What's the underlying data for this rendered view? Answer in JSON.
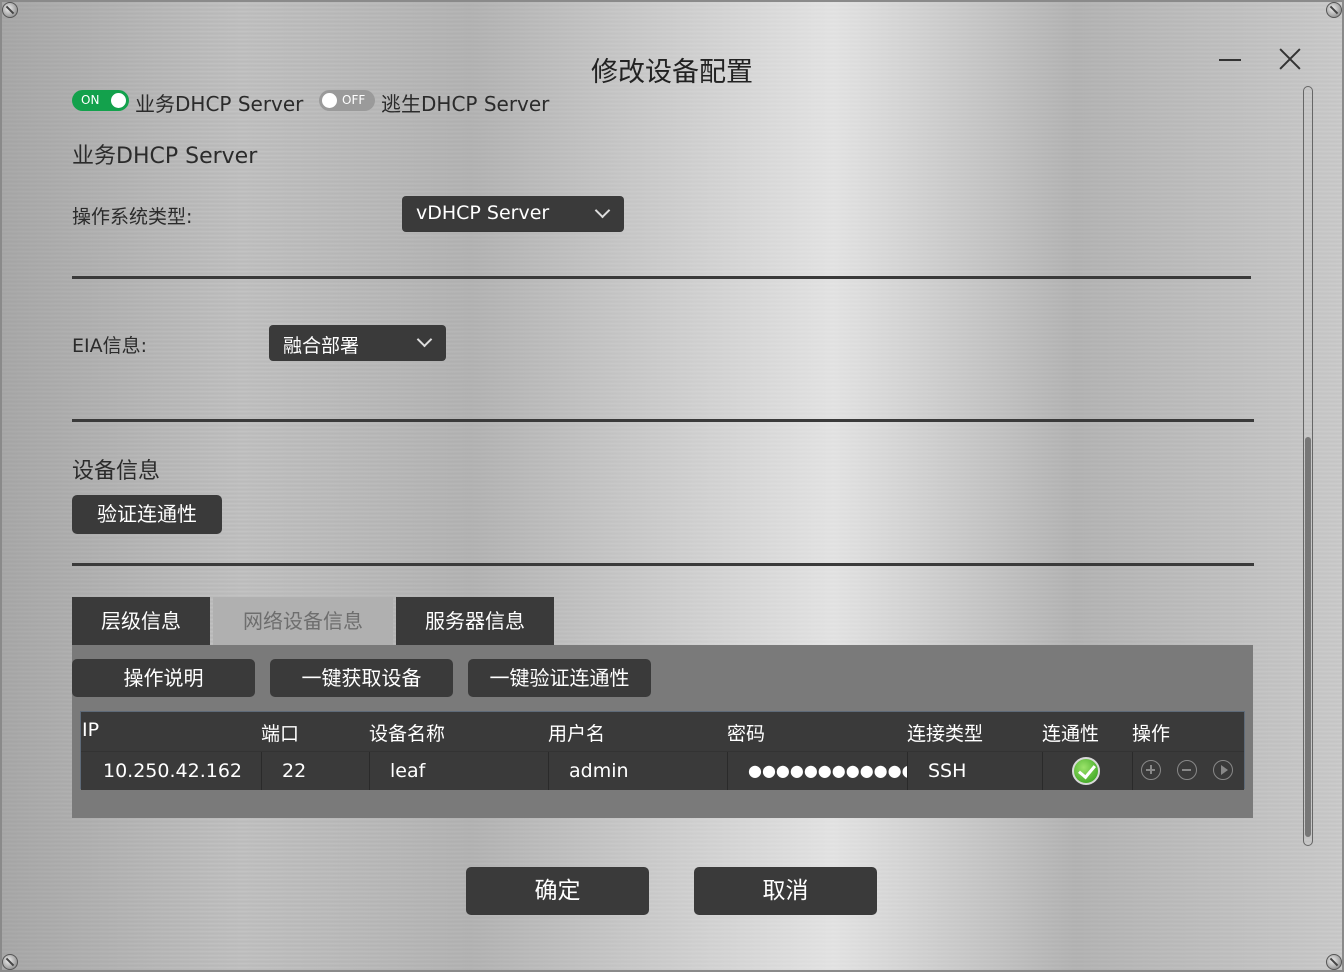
{
  "window": {
    "title": "修改设备配置"
  },
  "toggles": {
    "biz": {
      "state_label": "ON",
      "label": "业务DHCP Server"
    },
    "escape": {
      "state_label": "OFF",
      "label": "逃生DHCP Server"
    }
  },
  "section_biz": {
    "title": "业务DHCP Server"
  },
  "os_type": {
    "label": "操作系统类型:",
    "value": "vDHCP Server"
  },
  "eia": {
    "label": "EIA信息:",
    "value": "融合部署"
  },
  "device_info": {
    "title": "设备信息",
    "verify_button": "验证连通性"
  },
  "tabs": [
    {
      "label": "层级信息"
    },
    {
      "label": "网络设备信息"
    },
    {
      "label": "服务器信息"
    }
  ],
  "panel_buttons": {
    "help": "操作说明",
    "fetch": "一键获取设备",
    "verify_all": "一键验证连通性"
  },
  "table": {
    "headers": [
      "IP",
      "端口",
      "设备名称",
      "用户名",
      "密码",
      "连接类型",
      "连通性",
      "操作"
    ],
    "rows": [
      {
        "ip": "10.250.42.162",
        "port": "22",
        "name": "leaf",
        "user": "admin",
        "password": "●●●●●●●●●●●●●●",
        "conn_type": "SSH"
      }
    ]
  },
  "footer": {
    "ok": "确定",
    "cancel": "取消"
  },
  "icons": {
    "minimize": "minimize-icon",
    "close": "close-icon",
    "dropdown": "chevron-down-icon",
    "status_ok": "check-circle-icon",
    "add": "plus-circle-icon",
    "remove": "minus-circle-icon",
    "run": "play-circle-icon"
  },
  "colors": {
    "accent_on": "#13a14c",
    "dark": "#3a3a3a",
    "ok_green": "#2b9a15"
  }
}
